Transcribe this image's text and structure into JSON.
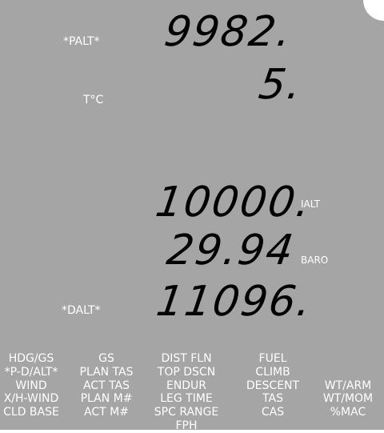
{
  "display": {
    "palt_label": "*PALT*",
    "palt_value": "9982.",
    "temp_label": "T°C",
    "temp_value": "5.",
    "ialt_value": "10000.",
    "ialt_unit": "IALT",
    "baro_value": "29.94",
    "baro_unit": "BARO",
    "dalt_label": "*DALT*",
    "dalt_value": "11096."
  },
  "menu": {
    "col1": [
      "HDG/GS",
      "*P-D/ALT*",
      "WIND",
      "X/H-WIND",
      "CLD BASE"
    ],
    "col2": [
      "GS",
      "PLAN TAS",
      "ACT TAS",
      "PLAN M#",
      "ACT M#"
    ],
    "col3": [
      "DIST FLN",
      "TOP DSCN",
      "ENDUR",
      "LEG TIME",
      "SPC RANGE",
      "FPH"
    ],
    "col4": [
      "FUEL",
      "CLIMB",
      "DESCENT",
      "TAS",
      "CAS"
    ],
    "col5": [
      "WT/ARM",
      "WT/MOM",
      "%MAC"
    ]
  }
}
